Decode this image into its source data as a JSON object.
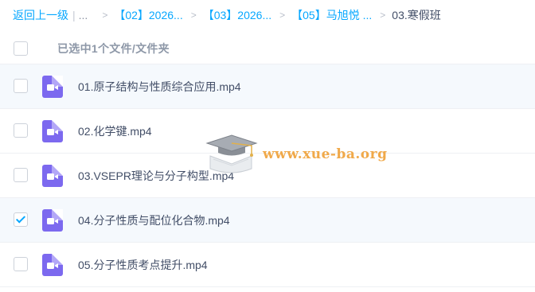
{
  "breadcrumb": {
    "back": "返回上一级",
    "pipe": "|",
    "ellipsis": "...",
    "items": [
      {
        "label": "【02】2026..."
      },
      {
        "label": "【03】2026..."
      },
      {
        "label": "【05】马旭悦 ..."
      }
    ],
    "separator": ">",
    "current": "03.寒假班"
  },
  "list_header": {
    "selection_text": "已选中1个文件/文件夹",
    "checked": false
  },
  "files": [
    {
      "name": "01.原子结构与性质综合应用.mp4",
      "checked": false,
      "state": "hovered",
      "icon": "video-file-icon"
    },
    {
      "name": "02.化学键.mp4",
      "checked": false,
      "state": "normal",
      "icon": "video-file-icon"
    },
    {
      "name": "03.VSEPR理论与分子构型.mp4",
      "checked": false,
      "state": "normal",
      "icon": "video-file-icon"
    },
    {
      "name": "04.分子性质与配位化合物.mp4",
      "checked": true,
      "state": "selected",
      "icon": "video-file-icon"
    },
    {
      "name": "05.分子性质考点提升.mp4",
      "checked": false,
      "state": "normal",
      "icon": "video-file-icon"
    }
  ],
  "watermark": {
    "text": "www.xue-ba.org",
    "icon": "graduation-cap-icon"
  },
  "colors": {
    "accent": "#06a7ff",
    "video_icon": "#7c69ef",
    "text": "#424e67",
    "watermark": "#f0a94a"
  }
}
